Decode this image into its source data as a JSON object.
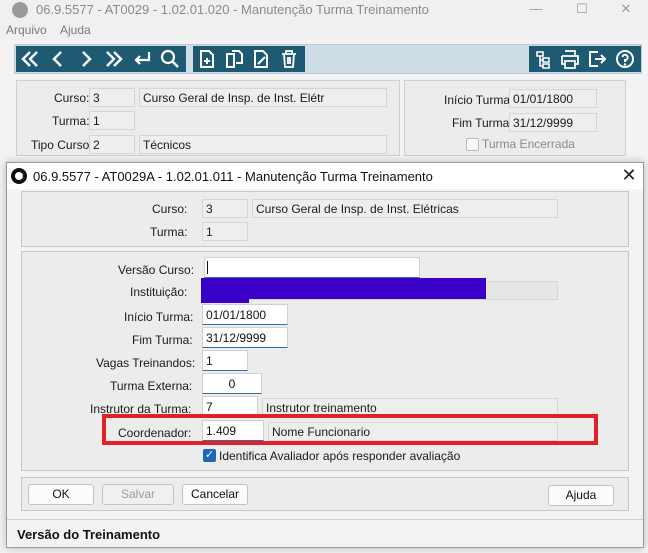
{
  "parent_window": {
    "title": "06.9.5577 - AT0029 - 1.02.01.020 - Manutenção Turma Treinamento",
    "controls": {
      "minimize": "—",
      "maximize": "☐",
      "close": "✕"
    },
    "menu": [
      "Arquivo",
      "Ajuda"
    ],
    "toolbar": {
      "nav_icons": [
        "first-record-icon",
        "previous-record-icon",
        "next-record-icon",
        "last-record-icon",
        "goto-icon",
        "search-icon"
      ],
      "edit_icons": [
        "new-record-icon",
        "copy-record-icon",
        "edit-record-icon",
        "delete-record-icon"
      ],
      "right_icons": [
        "hierarchy-icon",
        "print-icon",
        "exit-icon",
        "help-icon"
      ],
      "accent": "#1e5a72"
    },
    "form": {
      "curso_label": "Curso:",
      "curso_code": "3",
      "curso_desc": "Curso Geral de Insp. de Inst. Elétr",
      "turma_label": "Turma:",
      "turma_value": "1",
      "tipo_label": "Tipo Curso:",
      "tipo_code": "2",
      "tipo_desc": "Técnicos",
      "inicio_label": "Início Turma:",
      "inicio_value": "01/01/1800",
      "fim_label": "Fim Turma:",
      "fim_value": "31/12/9999",
      "encerrada_label": "Turma Encerrada"
    }
  },
  "dialog": {
    "title": "06.9.5577 - AT0029A - 1.02.01.011 - Manutenção Turma Treinamento",
    "close": "✕",
    "header": {
      "curso_label": "Curso:",
      "curso_code": "3",
      "curso_desc": "Curso Geral de Insp. de Inst. Elétricas",
      "turma_label": "Turma:",
      "turma_value": "1"
    },
    "fields": {
      "versao_label": "Versão Curso:",
      "versao_value": "",
      "instituicao_label": "Instituição:",
      "inicio_label": "Início Turma:",
      "inicio_value": "01/01/1800",
      "fim_label": "Fim Turma:",
      "fim_value": "31/12/9999",
      "vagas_label": "Vagas Treinandos:",
      "vagas_value": "1",
      "externa_label": "Turma Externa:",
      "externa_value": "0",
      "instrutor_label": "Instrutor da Turma:",
      "instrutor_code": "7",
      "instrutor_desc": "Instrutor treinamento",
      "coordenador_label": "Coordenador:",
      "coordenador_code": "1.409",
      "coordenador_desc": "Nome Funcionario",
      "avaliador_label": "Identifica Avaliador após responder avaliação",
      "avaliador_checked": true
    },
    "buttons": {
      "ok": "OK",
      "salvar": "Salvar",
      "cancelar": "Cancelar",
      "ajuda": "Ajuda"
    },
    "status": "Versão do Treinamento",
    "highlight_color": "#e0202a",
    "redaction_color": "#3a00c8"
  }
}
